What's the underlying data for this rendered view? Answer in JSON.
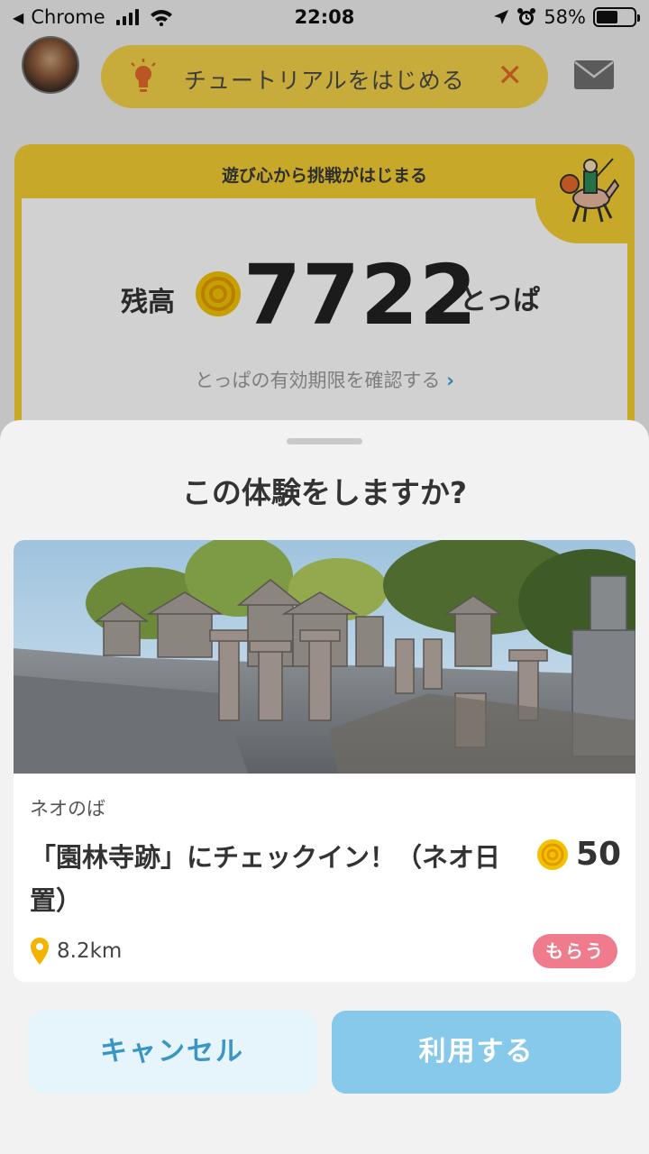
{
  "status_bar": {
    "back_label": "◀",
    "app_name": "Chrome",
    "time": "22:08",
    "battery_percent": "58%",
    "battery_level": 0.58
  },
  "header": {
    "tutorial_label": "チュートリアルをはじめる",
    "tutorial_close": "✕"
  },
  "balance_card": {
    "header_text": "遊び心から挑戦がはじまる",
    "balance_label": "残高",
    "balance_value": "7722",
    "balance_unit": "とっぱ",
    "expiry_link": "とっぱの有効期限を確認する",
    "expiry_chevron": "›"
  },
  "sheet": {
    "title": "この体験をしますか?",
    "experience": {
      "category": "ネオのば",
      "title": "「園林寺跡」にチェックイン！（ネオ日置）",
      "reward": "50",
      "distance": "8.2km",
      "badge": "もらう"
    },
    "cancel_label": "キャンセル",
    "use_label": "利用する"
  },
  "colors": {
    "accent_yellow": "#f3cd33",
    "cancel_text": "#3b96c6",
    "use_bg": "#86c9ea",
    "badge_pink": "#f07b8c",
    "close_orange": "#e26a2c"
  },
  "icons": [
    "signal-icon",
    "wifi-icon",
    "location-arrow-icon",
    "alarm-icon",
    "battery-icon",
    "avatar",
    "lightbulb-icon",
    "close-icon",
    "mail-icon",
    "coin-icon",
    "rider-illustration",
    "location-pin-icon"
  ]
}
